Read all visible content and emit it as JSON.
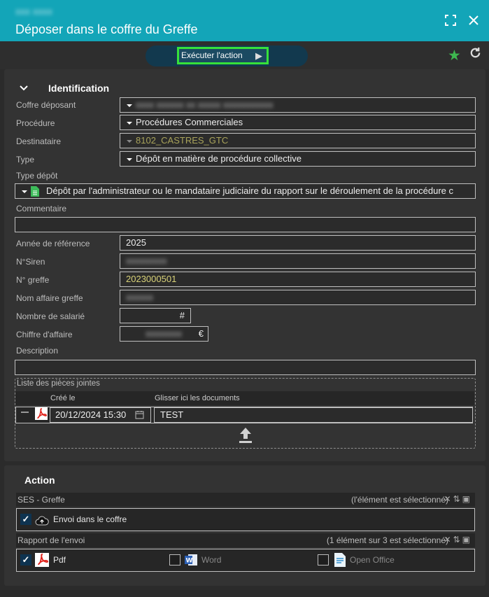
{
  "window": {
    "subtitle": "xxx xxxx",
    "title": "Déposer dans le coffre du Greffe",
    "fullscreen_icon": "fullscreen-icon",
    "close_icon": "close-icon"
  },
  "toolbar": {
    "execute_label": "Exécuter l'action",
    "favorite_color": "#3eb84f"
  },
  "identification": {
    "title": "Identification",
    "coffre_label": "Coffre déposant",
    "coffre_value": "xxxx xxxxxx xx xxxxx xxxxxxxxxxx",
    "procedure_label": "Procédure",
    "procedure_value": "Procédures Commerciales",
    "destinataire_label": "Destinataire",
    "destinataire_value": "8102_CASTRES_GTC",
    "type_label": "Type",
    "type_value": "Dépôt en matière de procédure collective",
    "type_depot_label": "Type dépôt",
    "type_depot_value": "Dépôt par l'administrateur ou le mandataire judiciaire du rapport sur le déroulement de la procédure c",
    "commentaire_label": "Commentaire",
    "commentaire_value": "",
    "annee_label": "Année de référence",
    "annee_value": "2025",
    "siren_label": "N°Siren",
    "siren_value": "xxxxxxxxx",
    "greffe_label": "N° greffe",
    "greffe_value": "2023000501",
    "nom_affaire_label": "Nom affaire greffe",
    "nom_affaire_value": "xxxxxx",
    "salaries_label": "Nombre de salarié",
    "salaries_suffix": "#",
    "chiffre_label": "Chiffre d'affaire",
    "chiffre_value": "xxxxxxxx",
    "chiffre_suffix": "€",
    "description_label": "Description",
    "description_value": ""
  },
  "attachments": {
    "list_label": "Liste des pièces jointes",
    "col_created": "Créé le",
    "col_docs": "Glisser ici les documents",
    "rows": [
      {
        "created": "20/12/2024 15:30",
        "name": "TEST"
      }
    ]
  },
  "action": {
    "title": "Action",
    "ses_label": "SES - Greffe",
    "ses_status": "(l'élément est sélectionné)",
    "ses_option": "Envoi dans le coffre",
    "report_label": "Rapport de l'envoi",
    "report_status": "(1 élément sur 3 est sélectionné)",
    "formats": [
      {
        "label": "Pdf",
        "checked": true
      },
      {
        "label": "Word",
        "checked": false
      },
      {
        "label": "Open Office",
        "checked": false
      }
    ]
  }
}
